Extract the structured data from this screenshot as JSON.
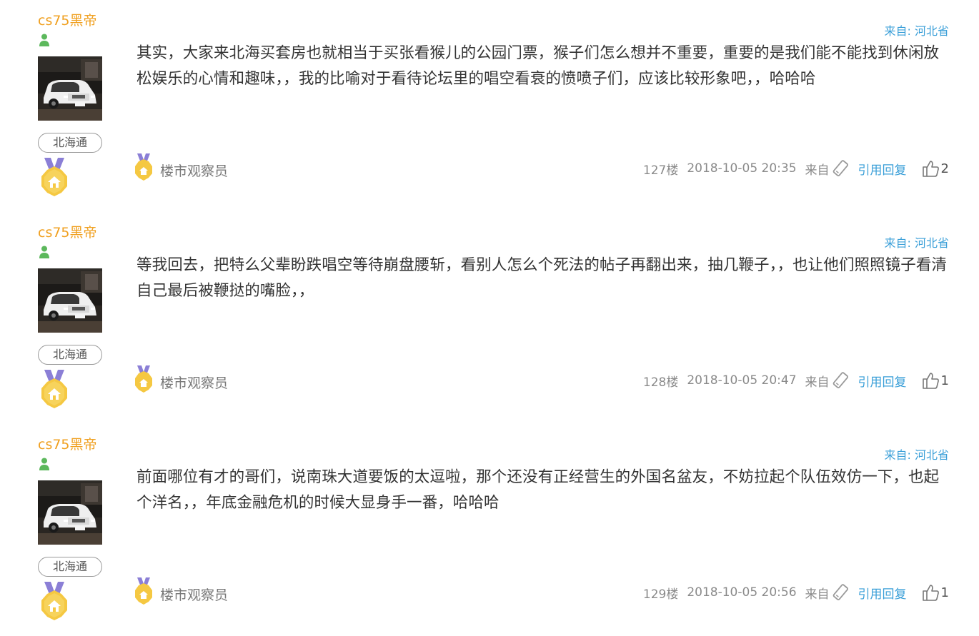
{
  "posts": [
    {
      "username": "cs75黑帝",
      "group": "北海通",
      "location": "来自: 河北省",
      "content": "其实，大家来北海买套房也就相当于买张看猴儿的公园门票，猴子们怎么想并不重要，重要的是我们能不能找到休闲放松娱乐的心情和趣味，，我的比喻对于看待论坛里的唱空看衰的愤喷子们，应该比较形象吧，，哈哈哈",
      "title": "楼市观察员",
      "floor": "127楼",
      "time": "2018-10-05 20:35",
      "from": "来自",
      "reply": "引用回复",
      "likes": "2"
    },
    {
      "username": "cs75黑帝",
      "group": "北海通",
      "location": "来自: 河北省",
      "content": "等我回去，把特么父辈盼跌唱空等待崩盘腰斩，看别人怎么个死法的帖子再翻出来，抽几鞭子，，也让他们照照镜子看清自己最后被鞭挞的嘴脸，，",
      "title": "楼市观察员",
      "floor": "128楼",
      "time": "2018-10-05 20:47",
      "from": "来自",
      "reply": "引用回复",
      "likes": "1"
    },
    {
      "username": "cs75黑帝",
      "group": "北海通",
      "location": "来自: 河北省",
      "content": "前面哪位有才的哥们，说南珠大道要饭的太逗啦，那个还没有正经营生的外国名盆友，不妨拉起个队伍效仿一下，也起个洋名，，年底金融危机的时候大显身手一番，哈哈哈",
      "title": "楼市观察员",
      "floor": "129楼",
      "time": "2018-10-05 20:56",
      "from": "来自",
      "reply": "引用回复",
      "likes": "1"
    }
  ],
  "icons": {
    "user": "user-icon",
    "medal": "house-medal-icon",
    "phone": "phone-icon",
    "like": "thumbs-up-icon"
  },
  "colors": {
    "username": "#f0a020",
    "link": "#3a9fd8",
    "text": "#333333",
    "meta": "#8a8a8a",
    "user_icon": "#5cb85c",
    "medal_gold": "#f5c842",
    "medal_ribbon": "#8b7fd6"
  }
}
